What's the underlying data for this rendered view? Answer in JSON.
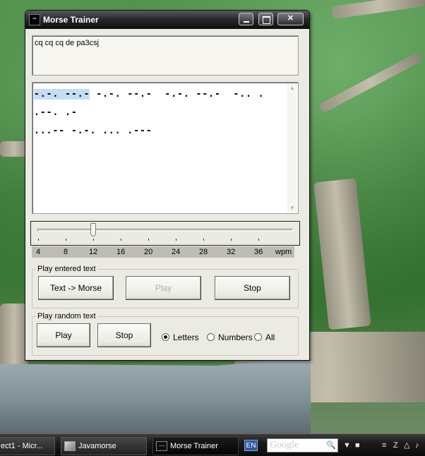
{
  "window": {
    "title": "Morse Trainer",
    "icon_label": "⋯"
  },
  "editor": {
    "input_text": "cq cq cq de pa3csj",
    "morse_selected": "-.-. --.-",
    "morse_rest": " -.-. --.-  -.-. --.-  -.. .  .--. .-\n...-- -.-. ... .---"
  },
  "speed": {
    "scale_labels": [
      "4",
      "8",
      "12",
      "16",
      "20",
      "24",
      "28",
      "32",
      "36",
      "wpm"
    ],
    "current_wpm": 12,
    "min_wpm": 4,
    "max_wpm": 40
  },
  "play_entered": {
    "group_label": "Play entered text",
    "text_to_morse_label": "Text -> Morse",
    "play_label": "Play",
    "stop_label": "Stop"
  },
  "play_random": {
    "group_label": "Play random text",
    "play_label": "Play",
    "stop_label": "Stop",
    "options": [
      "Letters",
      "Numbers",
      "All"
    ],
    "selected_option": "Letters"
  },
  "taskbar": {
    "items": [
      "ect1 - Micr...",
      "Javamorse",
      "Morse Trainer"
    ],
    "active_item": "Morse Trainer",
    "language": "EN",
    "search_text": "Google"
  },
  "colors": {
    "title_bar": "#1a1a1a",
    "window_bg": "#ecebe3",
    "selection": "#c6ddf7"
  }
}
